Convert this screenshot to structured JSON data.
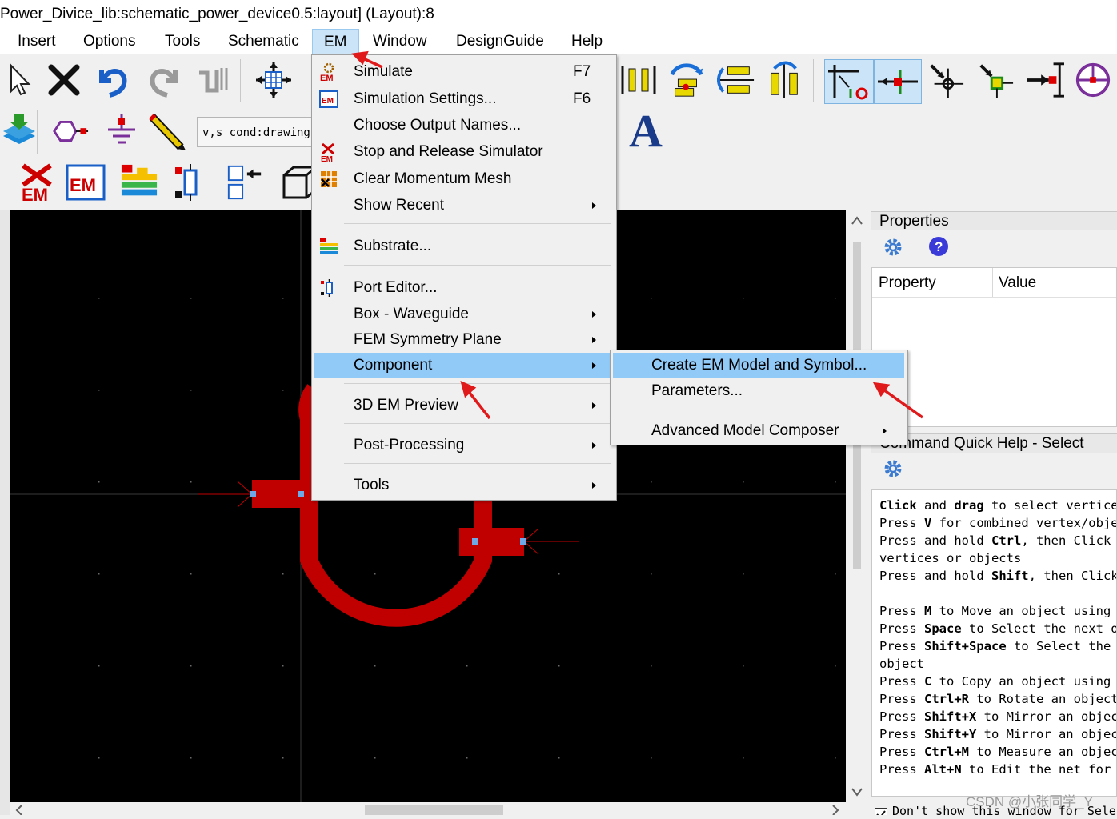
{
  "window": {
    "title": "Power_Divice_lib:schematic_power_device0.5:layout] (Layout):8"
  },
  "menubar": {
    "items": [
      {
        "label": "Insert"
      },
      {
        "label": "Options"
      },
      {
        "label": "Tools"
      },
      {
        "label": "Schematic"
      },
      {
        "label": "EM"
      },
      {
        "label": "Window"
      },
      {
        "label": "DesignGuide"
      },
      {
        "label": "Help"
      }
    ],
    "active": "EM"
  },
  "toolbar": {
    "command_field": "v,s cond:drawing",
    "text_tool_glyph": "A",
    "em_badge": "EM"
  },
  "em_menu": {
    "items": [
      {
        "label": "Simulate",
        "shortcut": "F7",
        "icon": "em-simulate-icon"
      },
      {
        "label": "Simulation Settings...",
        "shortcut": "F6",
        "icon": "em-settings-icon"
      },
      {
        "label": "Choose Output Names..."
      },
      {
        "label": "Stop and Release Simulator",
        "icon": "em-stop-icon"
      },
      {
        "label": "Clear Momentum Mesh",
        "icon": "mesh-icon"
      },
      {
        "label": "Show Recent",
        "submenu": true
      },
      {
        "label": "Substrate...",
        "icon": "substrate-icon"
      },
      {
        "label": "Port Editor...",
        "icon": "port-editor-icon"
      },
      {
        "label": "Box - Waveguide",
        "submenu": true
      },
      {
        "label": "FEM Symmetry Plane",
        "submenu": true
      },
      {
        "label": "Component",
        "submenu": true,
        "highlighted": true
      },
      {
        "label": "3D EM Preview",
        "submenu": true
      },
      {
        "label": "Post-Processing",
        "submenu": true
      },
      {
        "label": "Tools",
        "submenu": true
      }
    ]
  },
  "component_submenu": {
    "items": [
      {
        "label": "Create EM Model and Symbol...",
        "highlighted": true
      },
      {
        "label": "Parameters..."
      },
      {
        "label": "Advanced Model Composer",
        "submenu": true
      }
    ]
  },
  "properties_panel": {
    "title": "Properties",
    "columns": [
      "Property",
      "Value"
    ]
  },
  "quick_help": {
    "title": "Command Quick Help - Select",
    "lines": [
      [
        {
          "b": "Click"
        },
        {
          "t": " and "
        },
        {
          "b": "drag"
        },
        {
          "t": " to select vertices"
        }
      ],
      [
        {
          "t": "Press "
        },
        {
          "b": "V"
        },
        {
          "t": " for combined vertex/object"
        }
      ],
      [
        {
          "t": "Press and hold "
        },
        {
          "b": "Ctrl"
        },
        {
          "t": ", then Click a"
        }
      ],
      [
        {
          "t": "vertices or objects"
        }
      ],
      [
        {
          "t": "Press and hold "
        },
        {
          "b": "Shift"
        },
        {
          "t": ", then Click"
        }
      ],
      [
        {
          "t": ""
        }
      ],
      [
        {
          "t": "Press "
        },
        {
          "b": "M"
        },
        {
          "t": " to Move an object using r"
        }
      ],
      [
        {
          "t": "Press "
        },
        {
          "b": "Space"
        },
        {
          "t": " to Select the next ov"
        }
      ],
      [
        {
          "t": "Press "
        },
        {
          "b": "Shift+Space"
        },
        {
          "t": " to Select the p"
        }
      ],
      [
        {
          "t": "object"
        }
      ],
      [
        {
          "t": "Press "
        },
        {
          "b": "C"
        },
        {
          "t": " to Copy an object using r"
        }
      ],
      [
        {
          "t": "Press "
        },
        {
          "b": "Ctrl+R"
        },
        {
          "t": " to Rotate an object"
        }
      ],
      [
        {
          "t": "Press "
        },
        {
          "b": "Shift+X"
        },
        {
          "t": " to Mirror an object"
        }
      ],
      [
        {
          "t": "Press "
        },
        {
          "b": "Shift+Y"
        },
        {
          "t": " to Mirror an object"
        }
      ],
      [
        {
          "t": "Press "
        },
        {
          "b": "Ctrl+M"
        },
        {
          "t": " to Measure an object"
        }
      ],
      [
        {
          "t": "Press "
        },
        {
          "b": "Alt+N"
        },
        {
          "t": " to Edit the net for a"
        }
      ]
    ],
    "dont_show": "Don't show this window for Selec"
  },
  "watermark": "CSDN @小张同学_Y",
  "colors": {
    "menu_highlight": "#91c9f7",
    "trace": "#c00000",
    "canvas": "#000000",
    "annotation_arrow": "#e0191b",
    "pin": "#6fa8e6"
  }
}
